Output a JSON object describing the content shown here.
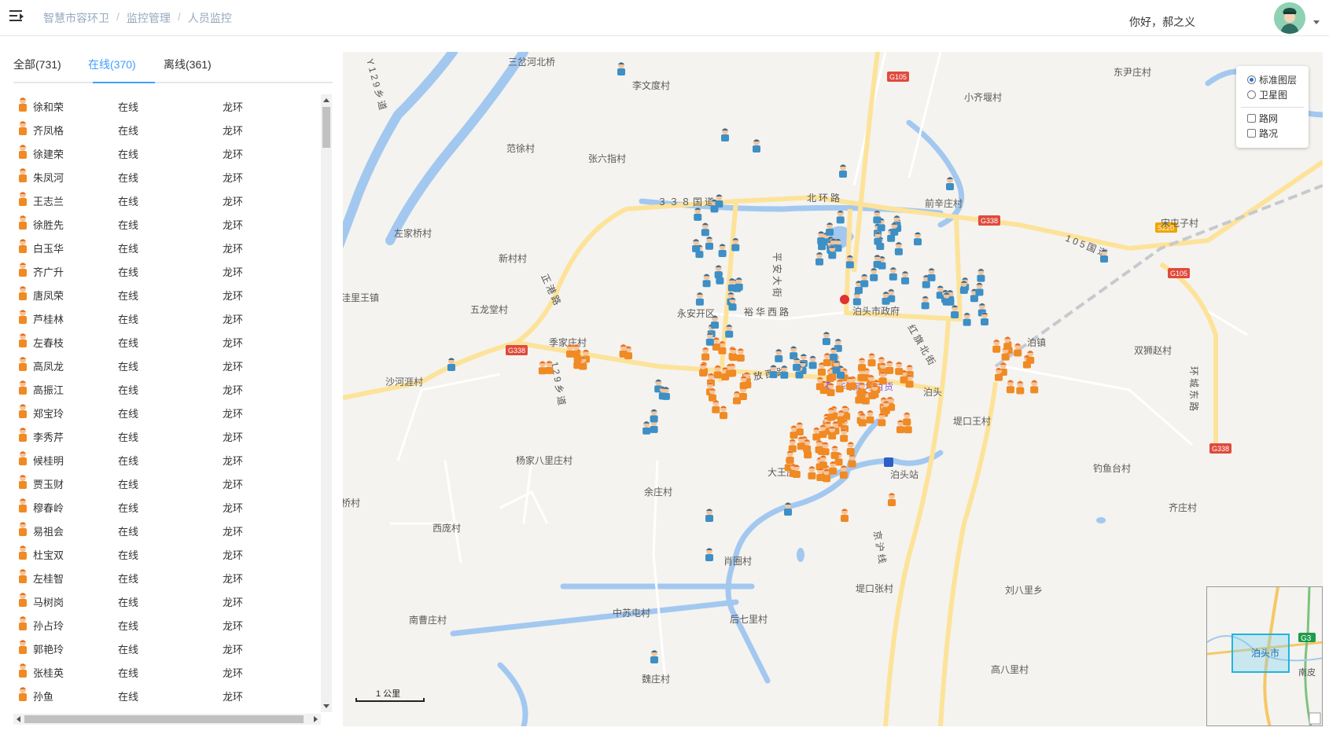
{
  "header": {
    "breadcrumb": [
      "智慧市容环卫",
      "监控管理",
      "人员监控"
    ],
    "greeting": "你好，郝之义"
  },
  "tabs": [
    {
      "label": "全部(731)",
      "active": false
    },
    {
      "label": "在线(370)",
      "active": true
    },
    {
      "label": "离线(361)",
      "active": false
    }
  ],
  "colors": {
    "accent": "#409eff",
    "worker_online": "#f08a24",
    "worker_offline": "#3d8fc6",
    "road": "#fde39a",
    "water": "#a3c8f0"
  },
  "workers": [
    {
      "name": "徐和荣",
      "status": "在线",
      "region": "龙环"
    },
    {
      "name": "齐凤格",
      "status": "在线",
      "region": "龙环"
    },
    {
      "name": "徐建荣",
      "status": "在线",
      "region": "龙环"
    },
    {
      "name": "朱凤河",
      "status": "在线",
      "region": "龙环"
    },
    {
      "name": "王志兰",
      "status": "在线",
      "region": "龙环"
    },
    {
      "name": "徐胜先",
      "status": "在线",
      "region": "龙环"
    },
    {
      "name": "白玉华",
      "status": "在线",
      "region": "龙环"
    },
    {
      "name": "齐广升",
      "status": "在线",
      "region": "龙环"
    },
    {
      "name": "唐凤荣",
      "status": "在线",
      "region": "龙环"
    },
    {
      "name": "芦桂林",
      "status": "在线",
      "region": "龙环"
    },
    {
      "name": "左春枝",
      "status": "在线",
      "region": "龙环"
    },
    {
      "name": "高凤龙",
      "status": "在线",
      "region": "龙环"
    },
    {
      "name": "高振江",
      "status": "在线",
      "region": "龙环"
    },
    {
      "name": "郑宝玲",
      "status": "在线",
      "region": "龙环"
    },
    {
      "name": "李秀芹",
      "status": "在线",
      "region": "龙环"
    },
    {
      "name": "候桂明",
      "status": "在线",
      "region": "龙环"
    },
    {
      "name": "贾玉财",
      "status": "在线",
      "region": "龙环"
    },
    {
      "name": "穆春岭",
      "status": "在线",
      "region": "龙环"
    },
    {
      "name": "易祖会",
      "status": "在线",
      "region": "龙环"
    },
    {
      "name": "杜宝双",
      "status": "在线",
      "region": "龙环"
    },
    {
      "name": "左桂智",
      "status": "在线",
      "region": "龙环"
    },
    {
      "name": "马树岗",
      "status": "在线",
      "region": "龙环"
    },
    {
      "name": "孙占玲",
      "status": "在线",
      "region": "龙环"
    },
    {
      "name": "郭艳玲",
      "status": "在线",
      "region": "龙环"
    },
    {
      "name": "张桂英",
      "status": "在线",
      "region": "龙环"
    },
    {
      "name": "孙鱼",
      "status": "在线",
      "region": "龙环"
    }
  ],
  "map": {
    "layer_options": [
      {
        "label": "标准图层",
        "type": "radio",
        "checked": true
      },
      {
        "label": "卫星图",
        "type": "radio",
        "checked": false
      },
      {
        "label": "路网",
        "type": "checkbox",
        "checked": false
      },
      {
        "label": "路况",
        "type": "checkbox",
        "checked": false
      }
    ],
    "scale_label": "1 公里",
    "overview_label": "泊头市",
    "overview_road_badge": "G3",
    "overview_place": "南皮",
    "road_badges": [
      "G105",
      "G338",
      "G338",
      "S220",
      "G105",
      "G338"
    ],
    "place_labels": [
      "三岔河北桥",
      "李文度村",
      "范徐村",
      "张六指村",
      "小齐堰村",
      "东尹庄村",
      "前辛庄村",
      "宋屯子村",
      "左家桥村",
      "新村村",
      "五龙堂村",
      "洼里王镇",
      "永安开区",
      "泊头市政府",
      "季家庄村",
      "沙河涯村",
      "泊镇",
      "双狮赵村",
      "泊头",
      "堤口王村",
      "杨家八里庄村",
      "大王庄",
      "泊头站",
      "钓鱼台村",
      "姜桥村",
      "余庄村",
      "西庞村",
      "齐庄村",
      "肖圈村",
      "堤口张村",
      "刘八里乡",
      "南曹庄村",
      "中苏屯村",
      "后七里村",
      "高八里村",
      "魏庄村",
      "庄"
    ],
    "road_labels": [
      "３３８国道",
      "北环路",
      "105国道",
      "正港路",
      "裕华西路",
      "平安大街",
      "红旗北街",
      "解放西路",
      "129乡道",
      "环城东路",
      "京沪线",
      "Y129乡道"
    ],
    "poi_labels": [
      "华联商场百货"
    ]
  }
}
